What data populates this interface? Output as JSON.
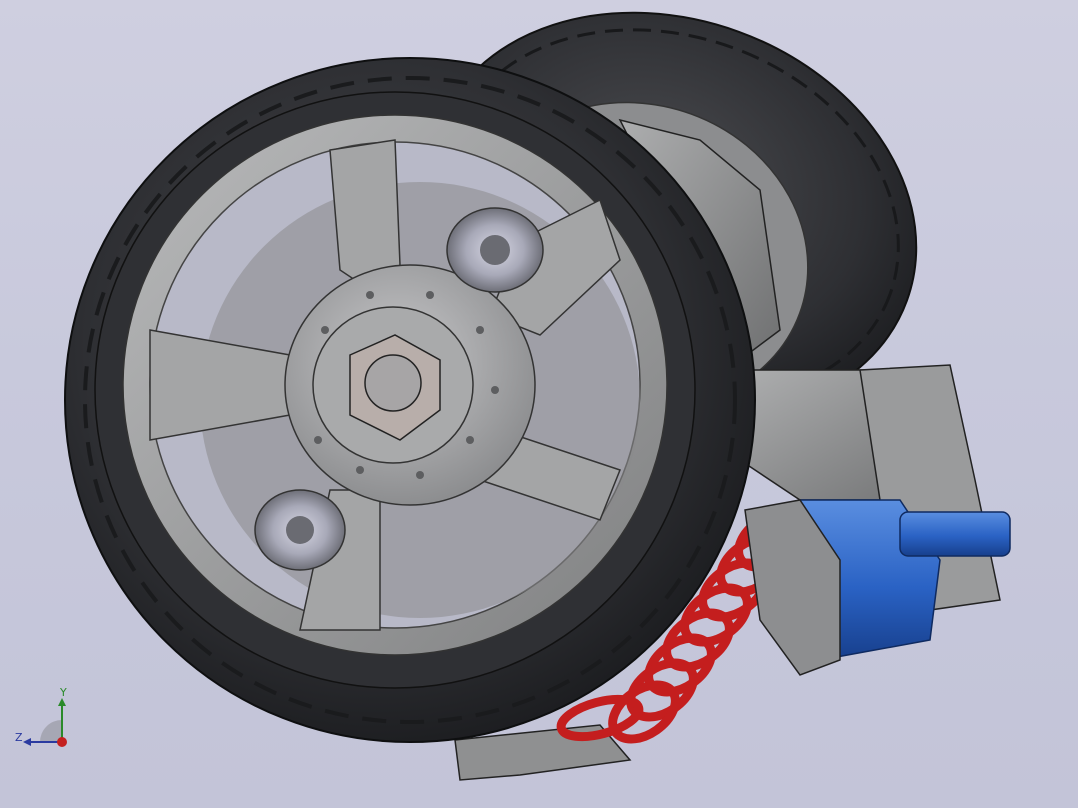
{
  "scene": {
    "background": "#c8c9dc",
    "tire_color": "#2d2e31",
    "rim_color": "#9a9b9c",
    "hub_color": "#a7a7a9",
    "spring_color": "#c41e1e",
    "damper_color": "#2a64c8",
    "bracket_color": "#8f9091"
  },
  "triad": {
    "y_label": "Y",
    "z_label": "Z",
    "y_color": "#2a8a2a",
    "z_color": "#2a3aa0",
    "x_color": "#c42020"
  }
}
